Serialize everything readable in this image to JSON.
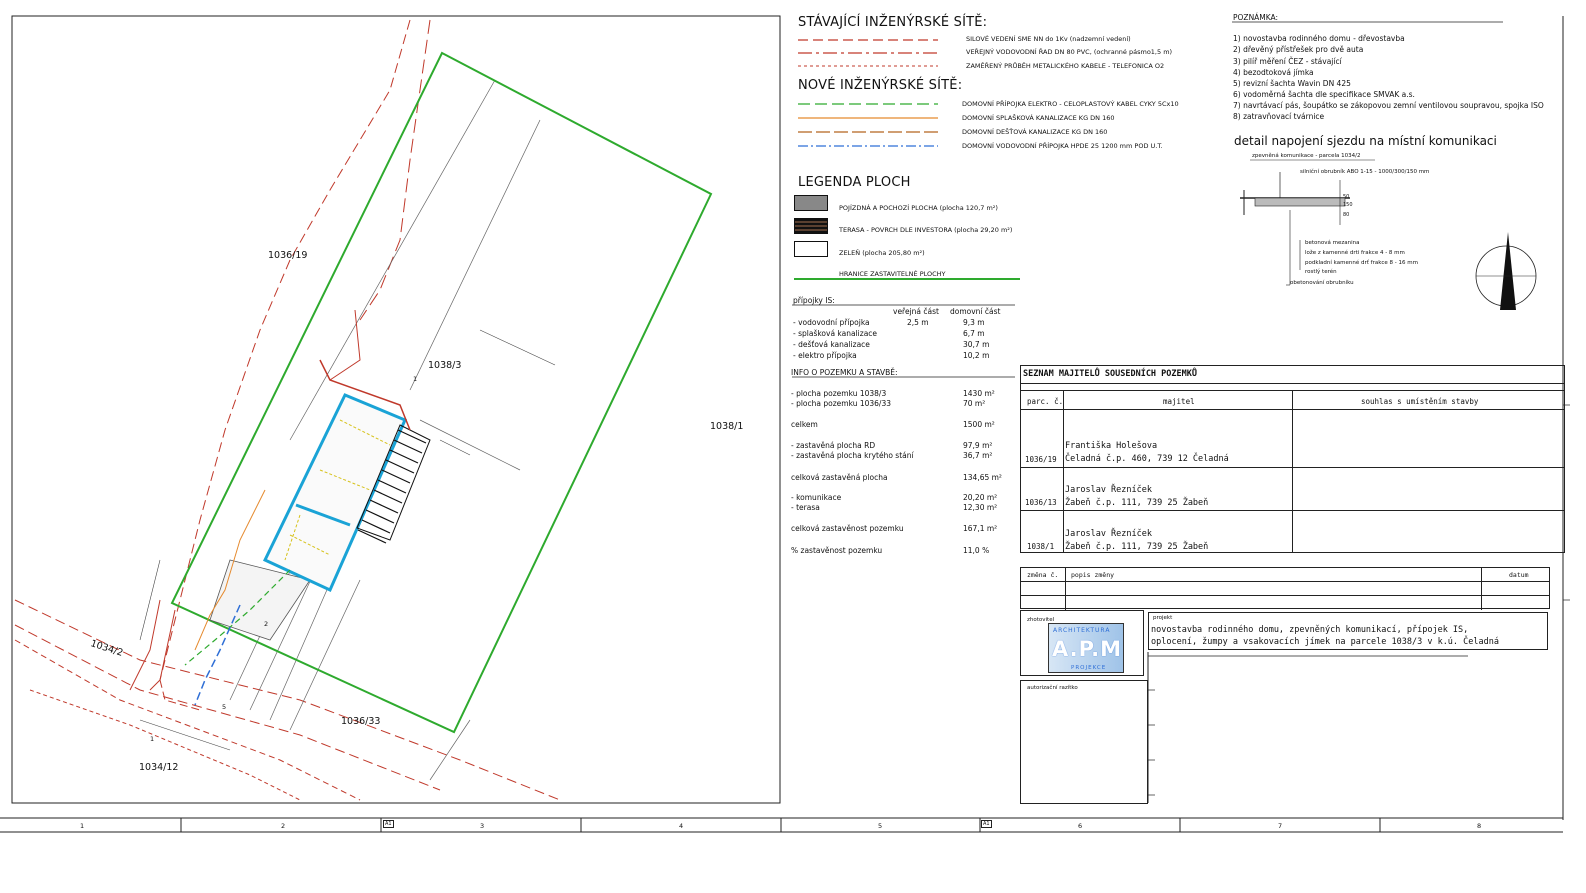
{
  "legend_existing": {
    "title": "STÁVAJÍCÍ INŽENÝRSKÉ SÍTĚ:",
    "items": [
      {
        "label": "SILOVÉ VEDENÍ SME NN do 1Kv (nadzemní vedení)",
        "color": "#c0392b"
      },
      {
        "label": "VEŘEJNÝ VODOVODNÍ ŘAD DN 80 PVC, (ochranné pásmo1,5 m)",
        "color": "#c0392b"
      },
      {
        "label": "ZAMĚŘENÝ PRŮBĚH METALICKÉHO KABELE - TELEFONICA O2",
        "color": "#c0392b"
      }
    ]
  },
  "legend_new": {
    "title": "NOVÉ INŽENÝRSKÉ SÍTĚ:",
    "items": [
      {
        "label": "DOMOVNÍ PŘÍPOJKA ELEKTRO - CELOPLASTOVÝ KABEL CYKY 5Cx10",
        "color": "#2eaa2e"
      },
      {
        "label": "DOMOVNÍ SPLAŠKOVÁ KANALIZACE KG DN 160",
        "color": "#e58a2e"
      },
      {
        "label": "DOMOVNÍ DEŠŤOVÁ KANALIZACE KG DN 160",
        "color": "#b5651d"
      },
      {
        "label": "DOMOVNÍ VODOVODNÍ PŘÍPOJKA HPDE 25 1200 mm POD U.T.",
        "color": "#2f6fd6"
      }
    ]
  },
  "legend_areas": {
    "title": "LEGENDA PLOCH",
    "items": [
      {
        "label": "POJÍZDNÁ A POCHOZÍ PLOCHA (plocha 120,7 m²)",
        "fill": "#888888"
      },
      {
        "label": "TERASA - POVRCH DLE INVESTORA (plocha 29,20 m²)",
        "fill": "#3a2a1a"
      },
      {
        "label": "ZELEŇ (plocha 205,80 m²)",
        "fill": "#ffffff"
      }
    ],
    "boundary_label": "HRANICE ZASTAVITELNÉ PLOCHY",
    "boundary_color": "#2eaa2e"
  },
  "connections": {
    "title": "přípojky IS:",
    "col_public": "veřejná část",
    "col_private": "domovní část",
    "rows": [
      {
        "name": "- vodovodní přípojka",
        "public": "2,5 m",
        "private": "9,3 m"
      },
      {
        "name": "- splašková kanalizace",
        "public": "",
        "private": "6,7 m"
      },
      {
        "name": "- dešťová kanalizace",
        "public": "",
        "private": "30,7 m"
      },
      {
        "name": "- elektro přípojka",
        "public": "",
        "private": "10,2 m"
      }
    ]
  },
  "info": {
    "title": "INFO O POZEMKU A STAVBĚ:",
    "rows": [
      {
        "name": "- plocha pozemku 1038/3",
        "value": "1430 m²"
      },
      {
        "name": "- plocha pozemku 1036/33",
        "value": "70 m²"
      },
      {
        "name": "celkem",
        "value": "1500 m²"
      },
      {
        "name": "- zastavěná plocha RD",
        "value": "97,9 m²"
      },
      {
        "name": "- zastavěná plocha krytého stání",
        "value": "36,7 m²"
      },
      {
        "name": "celková zastavěná plocha",
        "value": "134,65 m²"
      },
      {
        "name": "- komunikace",
        "value": "20,20 m²"
      },
      {
        "name": "- terasa",
        "value": "12,30 m²"
      },
      {
        "name": "celková zastavěnost pozemku",
        "value": "167,1 m²"
      },
      {
        "name": "% zastavěnost pozemku",
        "value": "11,0 %"
      }
    ]
  },
  "notes": {
    "title": "POZNÁMKA:",
    "items": [
      "1) novostavba rodinného domu - dřevostavba",
      "2) dřevěný přístřešek pro dvě auta",
      "3) pilíř měření ČEZ - stávající",
      "4) bezodtoková jímka",
      "5) revizní šachta Wavin DN 425",
      "6) vodoměrná šachta dle specifikace SMVAK a.s.",
      "7) navrtávací pás, šoupátko se zákopovou zemní ventilovou soupravou, spojka ISO",
      "8) zatravňovací tvárnice"
    ]
  },
  "detail": {
    "title": "detail napojení sjezdu na místní komunikaci",
    "top_label": "zpevněná komunikace - parcela 1034/2",
    "curb": "silniční obrubník ABO 1-15 - 1000/300/150 mm",
    "dims": [
      "50",
      "150",
      "80"
    ],
    "layers": [
      "betonová mezanina",
      "lože z kamenné drti frakce 4 - 8 mm",
      "podkladní kamenné drť frakce 8 - 16 mm",
      "rostlý terén",
      "obetonování obrubníku"
    ]
  },
  "owners": {
    "title": "SEZNAM MAJITELŮ SOUSEDNÍCH POZEMKŮ",
    "headers": [
      "parc. č.",
      "majitel",
      "souhlas s umístěním stavby"
    ],
    "rows": [
      {
        "parcel": "1036/19",
        "name": "Františka Holešova",
        "address": "Čeladná č.p. 460, 739 12 Čeladná"
      },
      {
        "parcel": "1036/13",
        "name": "Jaroslav Řezníček",
        "address": "Žabeň č.p. 111, 739 25 Žabeň"
      },
      {
        "parcel": "1038/1",
        "name": "Jaroslav Řezníček",
        "address": "Žabeň č.p. 111, 739 25 Žabeň"
      }
    ]
  },
  "changes": {
    "col_change": "změna č.",
    "col_desc": "popis změny",
    "col_date": "datum"
  },
  "title_block": {
    "author_label": "zhotovitel",
    "logo_top": "ARCHITEKTURA",
    "logo_main": "A.P.M",
    "logo_bottom": "PROJEKCE",
    "project_label": "projekt",
    "project_line1": "novostavba rodinného domu, zpevněných komunikací, přípojek IS,",
    "project_line2": "oplocení, žumpy a vsakovacích jímek na parcele 1038/3 v k.ú. Čeladná",
    "stamp_label": "autorizační razítko"
  },
  "parcels": {
    "p1": "1036/19",
    "p2": "1038/3",
    "p3": "1038/1",
    "p4": "1034/2",
    "p5": "1036/33",
    "p6": "1034/12"
  },
  "plan_marks": {
    "m1": "1",
    "m2": "2",
    "m5": "5",
    "m1b": "1"
  },
  "ruler": [
    "1",
    "2",
    "3",
    "4",
    "5",
    "6",
    "7",
    "8"
  ],
  "ruler_marks": [
    "A1",
    "A1"
  ]
}
